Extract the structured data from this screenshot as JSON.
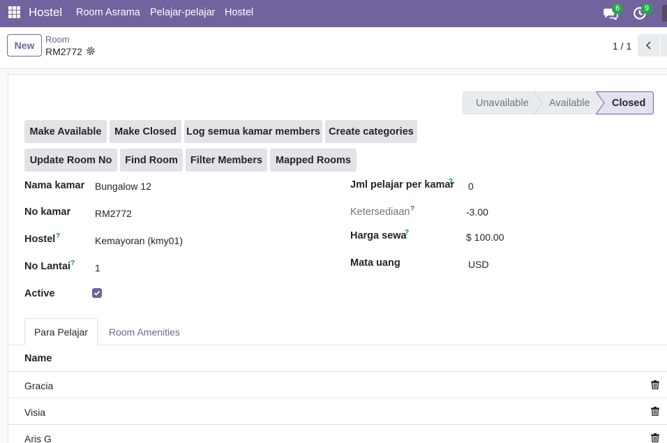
{
  "navbar": {
    "app_name": "Hostel",
    "menu": [
      "Room Asrama",
      "Pelajar-pelajar",
      "Hostel"
    ],
    "messages_count": "6",
    "activities_count": "9"
  },
  "breadcrumb": {
    "new_label": "New",
    "parent": "Room",
    "current": "RM2772"
  },
  "pager": {
    "text": "1 / 1"
  },
  "statusbar": {
    "stages": [
      "Unavailable",
      "Available",
      "Closed"
    ],
    "active": "Closed"
  },
  "actions": {
    "row1": [
      "Make Available",
      "Make Closed",
      "Log semua kamar members",
      "Create categories"
    ],
    "row2": [
      "Update Room No",
      "Find Room",
      "Filter Members",
      "Mapped Rooms"
    ]
  },
  "fields": {
    "nama_kamar": {
      "label": "Nama kamar",
      "value": "Bungalow 12"
    },
    "no_kamar": {
      "label": "No kamar",
      "value": "RM2772"
    },
    "hostel": {
      "label": "Hostel",
      "value": "Kemayoran (kmy01)"
    },
    "no_lantai": {
      "label": "No Lantai",
      "value": "1"
    },
    "active": {
      "label": "Active",
      "checked": true
    },
    "jml_pelajar": {
      "label": "Jml pelajar per kamar",
      "value": "0"
    },
    "ketersediaan": {
      "label": "Ketersediaan",
      "value": "-3.00"
    },
    "harga_sewa": {
      "label": "Harga sewa",
      "value": "$ 100.00"
    },
    "mata_uang": {
      "label": "Mata uang",
      "value": "USD"
    },
    "help_mark": "?"
  },
  "tabs": [
    "Para Pelajar",
    "Room Amenities"
  ],
  "table": {
    "header": "Name",
    "rows": [
      "Gracia",
      "Visia",
      "Aris G"
    ]
  },
  "colors": {
    "brand": "#71639e",
    "badge": "#28a745",
    "help": "#017e84"
  }
}
